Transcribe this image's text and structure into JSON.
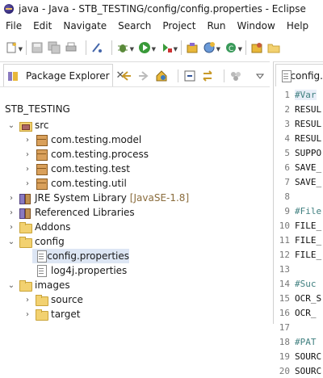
{
  "window": {
    "title": "java - Java - STB_TESTING/config/config.properties - Eclipse"
  },
  "menu": [
    "File",
    "Edit",
    "Navigate",
    "Search",
    "Project",
    "Run",
    "Window",
    "Help"
  ],
  "toolbar": {
    "icons": [
      "new-icon",
      "save-icon",
      "save-all-icon",
      "print-icon",
      "toggle-mark-icon",
      "debug-icon",
      "run-icon",
      "external-tools-icon",
      "new-java-project-icon",
      "new-package-icon",
      "new-class-icon",
      "open-type-icon",
      "open-folder-icon"
    ]
  },
  "package_explorer": {
    "tab_label": "Package Explorer",
    "project": "STB_TESTING",
    "tree": [
      {
        "label": "src",
        "type": "source-folder",
        "expanded": true
      },
      {
        "label": "com.testing.model",
        "type": "package"
      },
      {
        "label": "com.testing.process",
        "type": "package"
      },
      {
        "label": "com.testing.test",
        "type": "package"
      },
      {
        "label": "com.testing.util",
        "type": "package"
      },
      {
        "label": "JRE System Library",
        "decoration": "[JavaSE-1.8]",
        "type": "library"
      },
      {
        "label": "Referenced Libraries",
        "type": "library"
      },
      {
        "label": "Addons",
        "type": "folder"
      },
      {
        "label": "config",
        "type": "folder",
        "expanded": true
      },
      {
        "label": "config.properties",
        "type": "file",
        "selected": true
      },
      {
        "label": "log4j.properties",
        "type": "file"
      },
      {
        "label": "images",
        "type": "folder",
        "expanded": true
      },
      {
        "label": "source",
        "type": "folder"
      },
      {
        "label": "target",
        "type": "folder"
      }
    ]
  },
  "editor": {
    "tab_label": "config.",
    "lines": [
      {
        "num": "1",
        "text": "#Var",
        "kind": "comment"
      },
      {
        "num": "2",
        "text": "RESUL",
        "kind": "text"
      },
      {
        "num": "3",
        "text": "RESUL",
        "kind": "text"
      },
      {
        "num": "4",
        "text": "RESUL",
        "kind": "text"
      },
      {
        "num": "5",
        "text": "SUPPO",
        "kind": "text"
      },
      {
        "num": "6",
        "text": "SAVE_",
        "kind": "text"
      },
      {
        "num": "7",
        "text": "SAVE_",
        "kind": "text"
      },
      {
        "num": "8",
        "text": "",
        "kind": "text"
      },
      {
        "num": "9",
        "text": "#File",
        "kind": "comment"
      },
      {
        "num": "10",
        "text": "FILE_",
        "kind": "text"
      },
      {
        "num": "11",
        "text": "FILE_",
        "kind": "text"
      },
      {
        "num": "12",
        "text": "FILE_",
        "kind": "text"
      },
      {
        "num": "13",
        "text": "",
        "kind": "text"
      },
      {
        "num": "14",
        "text": "#Suc",
        "kind": "comment"
      },
      {
        "num": "15",
        "text": "OCR_S",
        "kind": "text"
      },
      {
        "num": "16",
        "text": "OCR_",
        "kind": "text"
      },
      {
        "num": "17",
        "text": "",
        "kind": "text"
      },
      {
        "num": "18",
        "text": "#PAT",
        "kind": "comment"
      },
      {
        "num": "19",
        "text": "SOURC",
        "kind": "text"
      },
      {
        "num": "20",
        "text": "SOURC",
        "kind": "text"
      }
    ]
  }
}
